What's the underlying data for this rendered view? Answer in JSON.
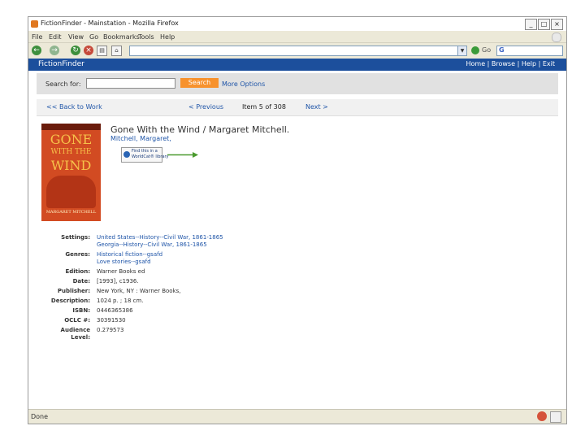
{
  "window": {
    "title": "FictionFinder - Mainstation - Mozilla Firefox",
    "buttons": [
      "_",
      "□",
      "×"
    ]
  },
  "menu": [
    "File",
    "Edit",
    "View",
    "Go",
    "Bookmarks",
    "Tools",
    "Help"
  ],
  "toolbar": {
    "url": "",
    "go_label": "Go",
    "search_engine_letter": "G"
  },
  "site": {
    "brand": "FictionFinder",
    "top_links": [
      "Home",
      "Browse",
      "Help",
      "Exit"
    ]
  },
  "search": {
    "label": "Search for:",
    "value": "",
    "button": "Search",
    "more": "More Options"
  },
  "pager": {
    "back": "<< Back to Work",
    "previous": "< Previous",
    "position": "Item 5 of 308",
    "next": "Next >"
  },
  "book": {
    "title": "Gone With the Wind / Margaret Mitchell.",
    "author": "Mitchell, Margaret,",
    "worldcat_badge": [
      "Find this in a",
      "WorldCat® library"
    ],
    "cover": {
      "line1": "GONE",
      "line2": "WITH THE",
      "line3": "WIND",
      "author": "MARGARET MITCHELL"
    }
  },
  "details": [
    {
      "key": "Settings:",
      "values": [
        "United States--History--Civil War, 1861-1865",
        "Georgia--History--Civil War, 1861-1865"
      ],
      "link": true
    },
    {
      "key": "Genres:",
      "values": [
        "Historical fiction--gsafd",
        "Love stories--gsafd"
      ],
      "link": true
    },
    {
      "key": "Edition:",
      "values": [
        "Warner Books ed"
      ],
      "link": false
    },
    {
      "key": "Date:",
      "values": [
        "[1993], c1936."
      ],
      "link": false
    },
    {
      "key": "Publisher:",
      "values": [
        "New York, NY : Warner Books,"
      ],
      "link": false
    },
    {
      "key": "Description:",
      "values": [
        "1024 p. ; 18 cm."
      ],
      "link": false
    },
    {
      "key": "ISBN:",
      "values": [
        "0446365386"
      ],
      "link": false
    },
    {
      "key": "OCLC #:",
      "values": [
        "30391530"
      ],
      "link": false
    },
    {
      "key": "Audience Level:",
      "values": [
        "0.279573"
      ],
      "link": false
    }
  ],
  "status": {
    "text": "Done"
  }
}
